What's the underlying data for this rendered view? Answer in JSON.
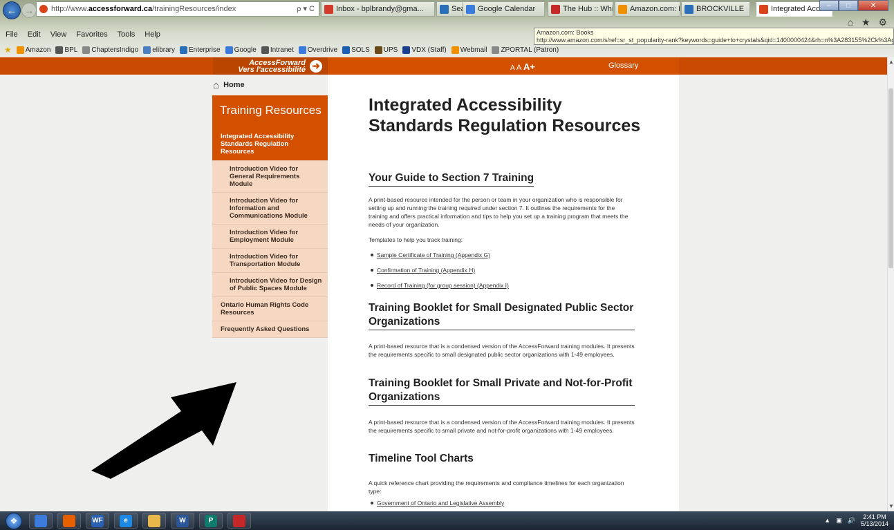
{
  "browser": {
    "address": {
      "prefix": "http://www.",
      "domain": "accessforward.ca",
      "path": "/trainingResources/index"
    },
    "address_tools": "ρ ▾ C",
    "tabs": [
      {
        "label": "Inbox - bplbrandy@gma...",
        "icon": "gmail-icon",
        "color": "#d23a2b"
      },
      {
        "label": "Search Results for jung",
        "icon": "globe-icon",
        "color": "#2b6fb8"
      },
      {
        "label": "Google Calendar",
        "icon": "calendar-icon",
        "color": "#3b7bdc"
      },
      {
        "label": "The Hub :: Whitehots",
        "icon": "w-icon",
        "color": "#c62828"
      },
      {
        "label": "Amazon.com: Books",
        "icon": "amazon-icon",
        "color": "#f09000"
      },
      {
        "label": "BROCKVILLE",
        "icon": "globe-icon",
        "color": "#2b6fb8"
      },
      {
        "label": "Integrated Accessibili...",
        "icon": "accessforward-icon",
        "color": "#d9431a"
      }
    ],
    "tooltip": {
      "title": "Amazon.com: Books",
      "url": "http://www.amazon.com/s/ref=sr_st_popularity-rank?keywords=guide+to+crystals&qid=1400000424&rh=n%3A283155%2Ck%3Aguide+to+cry..."
    },
    "menu": [
      "File",
      "Edit",
      "View",
      "Favorites",
      "Tools",
      "Help"
    ],
    "favorites": [
      {
        "label": "Amazon",
        "color": "#f09000"
      },
      {
        "label": "BPL",
        "color": "#555"
      },
      {
        "label": "ChaptersIndigo",
        "color": "#888"
      },
      {
        "label": "elibrary",
        "color": "#4a7fc1"
      },
      {
        "label": "Enterprise",
        "color": "#2b6fb8"
      },
      {
        "label": "Google",
        "color": "#3b7bdc"
      },
      {
        "label": "Intranet",
        "color": "#555"
      },
      {
        "label": "Overdrive",
        "color": "#3b7bdc"
      },
      {
        "label": "SOLS",
        "color": "#1a5fb4"
      },
      {
        "label": "UPS",
        "color": "#6b4a1a"
      },
      {
        "label": "VDX (Staff)",
        "color": "#1a3f8f"
      },
      {
        "label": "Webmail",
        "color": "#f09000"
      },
      {
        "label": "ZPORTAL (Patron)",
        "color": "#888"
      }
    ],
    "window_buttons": {
      "min": "–",
      "max": "□",
      "close": "✕"
    },
    "right_icons": "⌂ ★ ⚙"
  },
  "site": {
    "logo": {
      "line1": "AccessForward",
      "line2": "Vers l'accessibilité"
    },
    "text_size": {
      "small": "A",
      "medium": "A",
      "large": "A+"
    },
    "glossary": "Glossary",
    "accent": "#d25000"
  },
  "sidebar": {
    "home": "Home",
    "title": "Training Resources",
    "current": "Integrated Accessibility Standards Regulation Resources",
    "subitems": [
      "Introduction Video for General Requirements Module",
      "Introduction Video for Information and Communications Module",
      "Introduction Video for Employment Module",
      "Introduction Video for Transportation Module",
      "Introduction Video for Design of Public Spaces Module"
    ],
    "items": [
      "Ontario Human Rights Code Resources",
      "Frequently Asked Questions"
    ]
  },
  "content": {
    "title": "Integrated Accessibility Standards Regulation Resources",
    "s1": {
      "heading": "Your Guide to Section 7 Training",
      "text": "A print-based resource intended for the person or team in your organization who is responsible for setting up and running the training required under section 7. It outlines the requirements for the training and offers practical information and tips to help you set up a training program that meets the needs of your organization.",
      "templates_label": "Templates to help you track training:",
      "links": [
        "Sample Certificate of Training (Appendix G)",
        "Confirmation of Training (Appendix H)",
        "Record of Training (for group session) (Appendix I)"
      ]
    },
    "s2": {
      "heading": "Training Booklet for Small Designated Public Sector Organizations",
      "text": "A print-based resource that is a condensed version of the AccessForward training modules. It presents the requirements specific to small designated public sector organizations with 1-49 employees."
    },
    "s3": {
      "heading": "Training Booklet for Small Private and Not-for-Profit Organizations",
      "text": "A print-based resource that is a condensed version of the AccessForward training modules. It presents the requirements specific to small private and not-for-profit organizations with 1-49 employees."
    },
    "s4": {
      "heading": "Timeline Tool Charts",
      "text": "A quick reference chart providing the requirements and compliance timelines for each organization type:",
      "links": [
        "Government of Ontario and Legislative Assembly"
      ]
    }
  },
  "taskbar": {
    "apps": [
      {
        "label": "",
        "name": "file-explorer-icon",
        "color": "#3b7bdc"
      },
      {
        "label": "",
        "name": "firefox-icon",
        "color": "#e66000"
      },
      {
        "label": "WF",
        "name": "wordperfect-icon",
        "color": "#2b5fb4"
      },
      {
        "label": "e",
        "name": "internet-explorer-icon",
        "color": "#1e88e5"
      },
      {
        "label": "",
        "name": "folder-icon",
        "color": "#e8b84a"
      },
      {
        "label": "W",
        "name": "word-icon",
        "color": "#2b579a"
      },
      {
        "label": "P",
        "name": "publisher-icon",
        "color": "#0f7b6c"
      },
      {
        "label": "",
        "name": "acrobat-icon",
        "color": "#c62828"
      }
    ],
    "time": "2:41 PM",
    "date": "5/13/2014"
  }
}
